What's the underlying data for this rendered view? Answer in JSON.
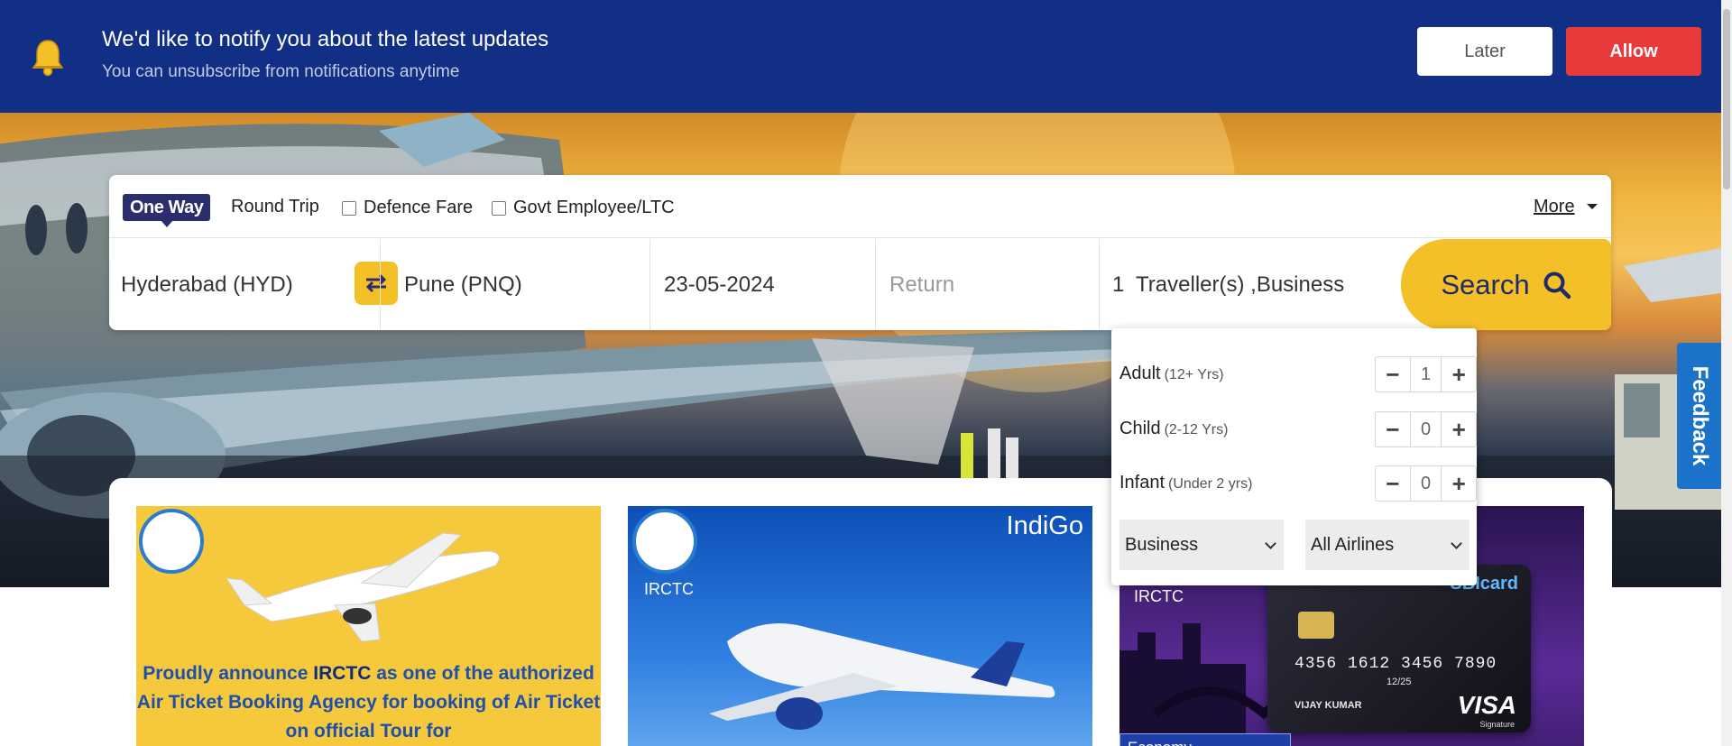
{
  "notification": {
    "title": "We'd like to notify you about the latest updates",
    "subtitle": "You can unsubscribe from notifications anytime",
    "later_label": "Later",
    "allow_label": "Allow",
    "colors": {
      "bar": "#122f86",
      "allow": "#e8393b"
    }
  },
  "search": {
    "trip_types": {
      "one_way": "One Way",
      "round_trip": "Round Trip"
    },
    "options": {
      "defence_fare": "Defence Fare",
      "govt_employee": "Govt Employee/LTC"
    },
    "more_label": "More",
    "from": "Hyderabad (HYD)",
    "to": "Pune (PNQ)",
    "depart_date": "23-05-2024",
    "return_placeholder": "Return",
    "travellers_count": "1",
    "travellers_summary": "Traveller(s) ,Business",
    "search_label": "Search",
    "colors": {
      "accent": "#f4c027",
      "brand": "#2a2d6e"
    }
  },
  "travellers": {
    "adult": {
      "label": "Adult",
      "sub": "(12+ Yrs)",
      "value": "1"
    },
    "child": {
      "label": "Child",
      "sub": "(2-12 Yrs)",
      "value": "0"
    },
    "infant": {
      "label": "Infant",
      "sub": "(Under 2 yrs)",
      "value": "0"
    },
    "class_selected": "Business",
    "airline_selected": "All Airlines"
  },
  "feedback_label": "Feedback",
  "cards": {
    "card1": {
      "text_prefix": "Proudly announce ",
      "text_brand": "IRCTC",
      "text_rest": " as one of the authorized Air Ticket Booking Agency for booking of Air Ticket on official Tour for"
    },
    "card2": {
      "brand": "IndiGo",
      "label": "IRCTC"
    },
    "card3": {
      "label": "IRCTC",
      "card_brand": "SBIcard",
      "card_number": "4356 1612 3456 7890",
      "card_expiry": "12/25",
      "card_holder": "VIJAY KUMAR",
      "card_network": "VISA",
      "card_network_sub": "Signature",
      "tag": "Economy"
    }
  }
}
